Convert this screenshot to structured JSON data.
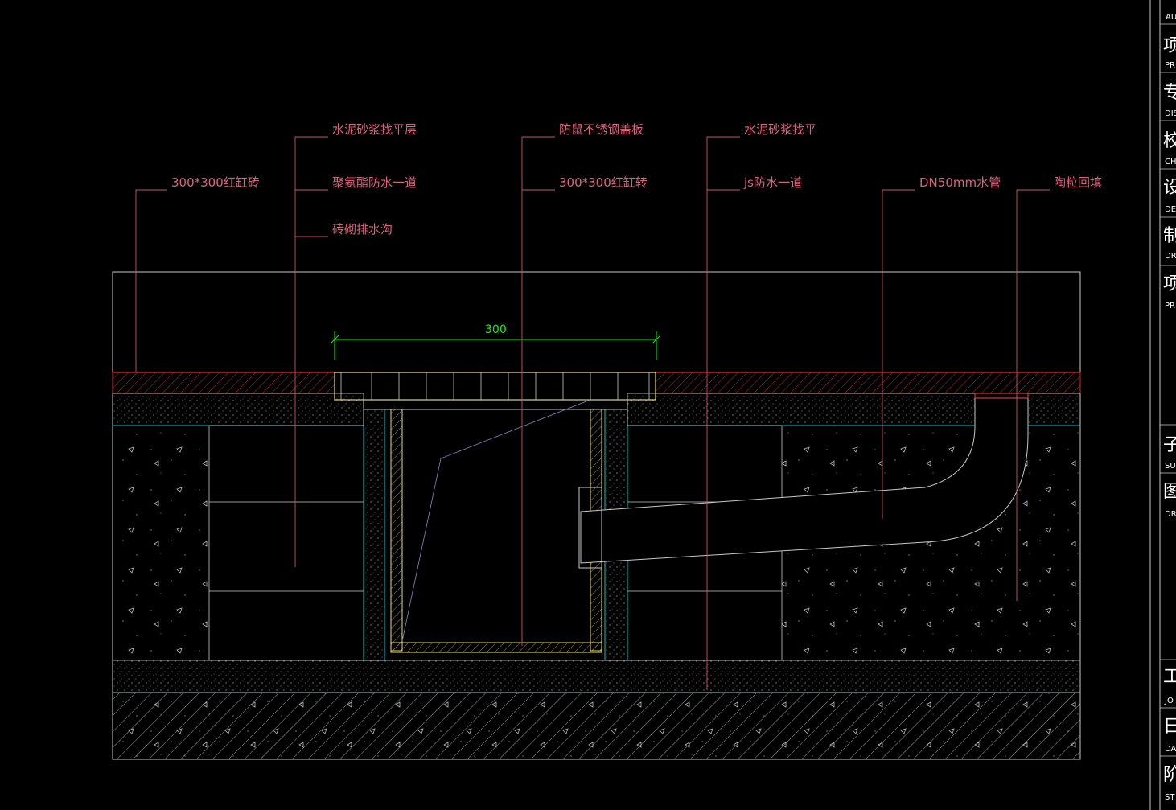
{
  "labels": {
    "l1": "水泥砂浆找平层",
    "l2": "聚氨酯防水一道",
    "l3": "砖砌排水沟",
    "l4": "防鼠不锈钢盖板",
    "l5": "300*300红缸砖",
    "l6": "300*300红缸转",
    "l7": "水泥砂浆找平",
    "l8": "js防水一道",
    "l9": "DN50mm水管",
    "l10": "陶粒回填"
  },
  "dimension": {
    "value": "300"
  },
  "title_block": {
    "rows": [
      {
        "big": "",
        "small": "AU"
      },
      {
        "big": "项",
        "small": "PR"
      },
      {
        "big": "专",
        "small": "DIS"
      },
      {
        "big": "校",
        "small": "CH"
      },
      {
        "big": "设",
        "small": "DE"
      },
      {
        "big": "制",
        "small": "DR"
      },
      {
        "big": "项",
        "small": "PR"
      },
      {
        "big": "子",
        "small": "SU"
      },
      {
        "big": "图",
        "small": "DR"
      },
      {
        "big": "工",
        "small": "JO"
      },
      {
        "big": "日",
        "small": "DA"
      },
      {
        "big": "阶",
        "small": "ST"
      }
    ]
  },
  "colors": {
    "background": "#000000",
    "label": "#e0607e",
    "leader": "#d05070",
    "outline": "#c8c8c8",
    "waterproof": "#00c8c8",
    "tile_red": "#e02020",
    "cover_yellow": "#e8e060",
    "dimension_green": "#00ff00"
  }
}
